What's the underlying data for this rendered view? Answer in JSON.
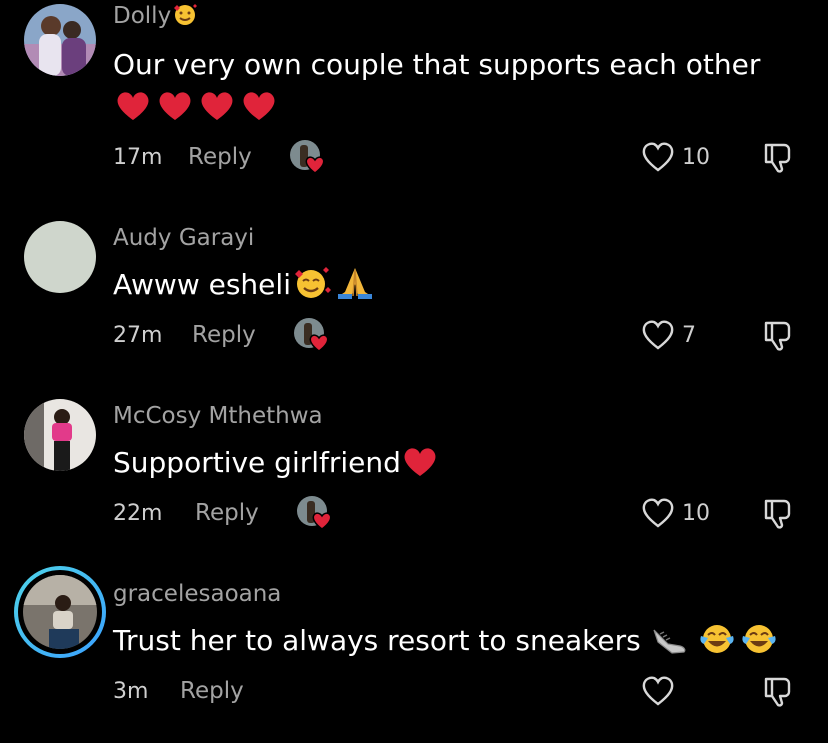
{
  "comments": [
    {
      "username": "Dolly",
      "username_emoji": "smiling-face-with-hearts",
      "text": "Our very own couple that supports each other",
      "text_line2_emoji": "four red hearts",
      "time": "17m",
      "reply_label": "Reply",
      "likes": "10"
    },
    {
      "username": "Audy Garayi",
      "text": "Awww esheli",
      "trailing_emoji": "smiling-face-with-hearts, folded-hands",
      "time": "27m",
      "reply_label": "Reply",
      "likes": "7"
    },
    {
      "username": "McCosy Mthethwa",
      "text": "Supportive girlfriend",
      "trailing_emoji": "red-heart",
      "time": "22m",
      "reply_label": "Reply",
      "likes": "10"
    },
    {
      "username": "gracelesaoana",
      "text": "Trust her to always resort to sneakers",
      "trailing_emoji": "sneaker, face-with-tears-of-joy x2",
      "time": "3m",
      "reply_label": "Reply",
      "likes": ""
    }
  ],
  "colors": {
    "background": "#000000",
    "username": "#a3a3a3",
    "text": "#ffffff",
    "heart_red": "#e0243a",
    "story_ring_start": "#4fd4e8",
    "story_ring_end": "#3aa0ff"
  },
  "icons": {
    "like": "heart-outline-icon",
    "dislike": "thumbs-down-icon",
    "creator_liked": "creator-liked-badge-icon"
  }
}
